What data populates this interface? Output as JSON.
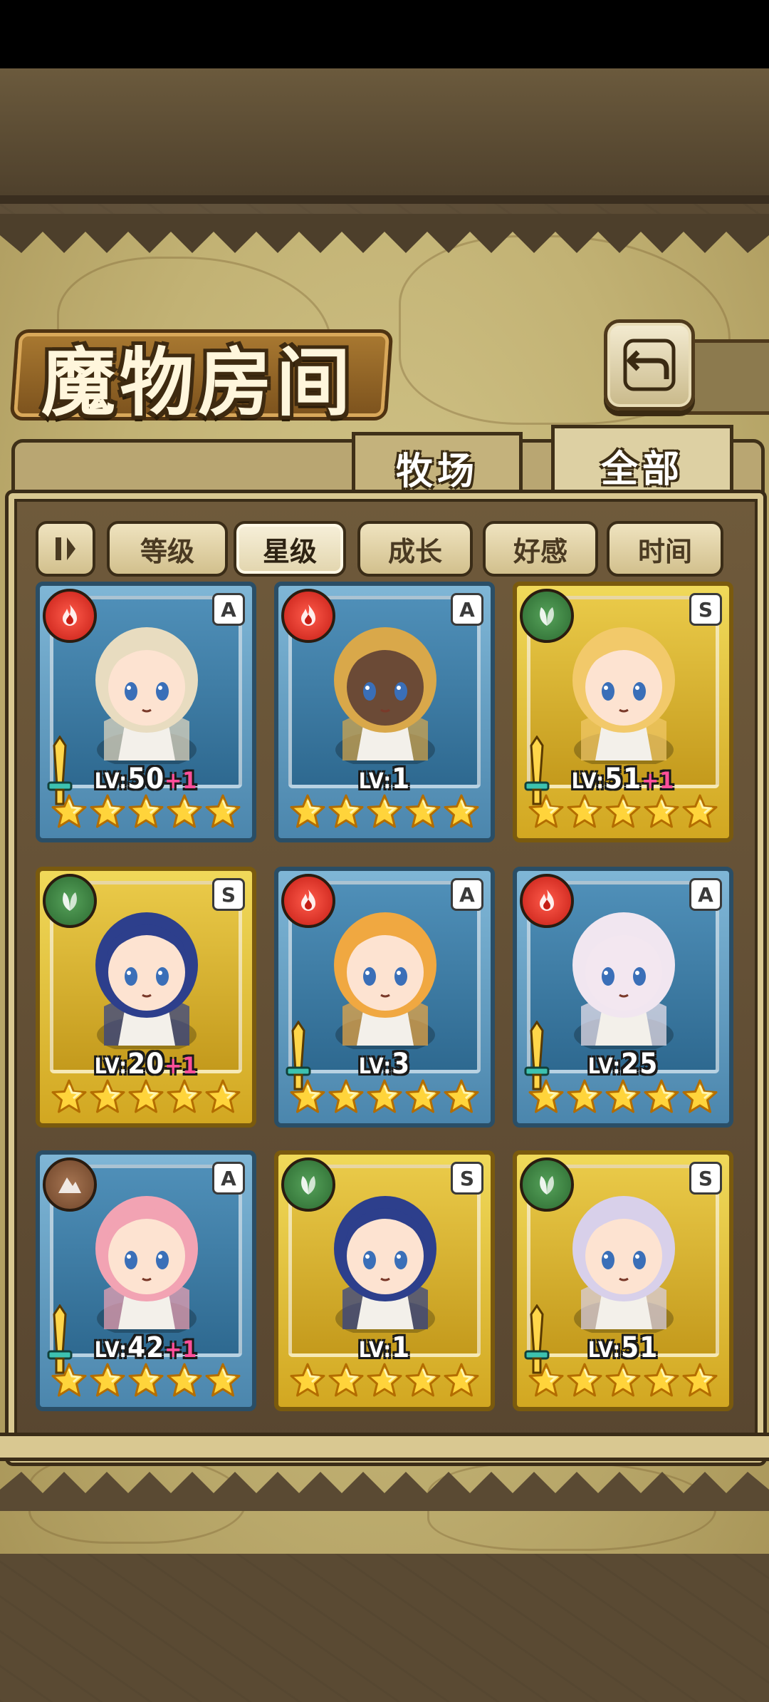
{
  "header": {
    "title": "魔物房间"
  },
  "tabs": [
    {
      "label": "牧场",
      "active": false
    },
    {
      "label": "全部",
      "active": true
    }
  ],
  "sort": {
    "buttons": [
      {
        "label": "等级",
        "active": false
      },
      {
        "label": "星级",
        "active": true
      },
      {
        "label": "成长",
        "active": false
      },
      {
        "label": "好感",
        "active": false
      },
      {
        "label": "时间",
        "active": false
      }
    ]
  },
  "monsters": [
    {
      "element": "fire",
      "rank": "A",
      "level_label": "LV:",
      "level": "50",
      "bonus": "+1",
      "stars": 5,
      "weapon": true,
      "hair": "#e8dcc0",
      "skin": "#fde3d1"
    },
    {
      "element": "fire",
      "rank": "A",
      "level_label": "LV:",
      "level": "1",
      "bonus": "",
      "stars": 5,
      "weapon": false,
      "hair": "#d9a84a",
      "skin": "#6b4a36"
    },
    {
      "element": "wood",
      "rank": "S",
      "level_label": "LV:",
      "level": "51",
      "bonus": "+1",
      "stars": 5,
      "weapon": true,
      "hair": "#f2c96a",
      "skin": "#fde3d1"
    },
    {
      "element": "wood",
      "rank": "S",
      "level_label": "LV:",
      "level": "20",
      "bonus": "+1",
      "stars": 5,
      "weapon": false,
      "hair": "#2d3f8c",
      "skin": "#fde3d1"
    },
    {
      "element": "fire",
      "rank": "A",
      "level_label": "LV:",
      "level": "3",
      "bonus": "",
      "stars": 5,
      "weapon": true,
      "hair": "#f0a841",
      "skin": "#fde3d1"
    },
    {
      "element": "fire",
      "rank": "A",
      "level_label": "LV:",
      "level": "25",
      "bonus": "",
      "stars": 5,
      "weapon": true,
      "hair": "#f1e6f0",
      "skin": "#f3e7f0"
    },
    {
      "element": "earth",
      "rank": "A",
      "level_label": "LV:",
      "level": "42",
      "bonus": "+1",
      "stars": 5,
      "weapon": true,
      "hair": "#f2a3b3",
      "skin": "#fde3d1"
    },
    {
      "element": "wood",
      "rank": "S",
      "level_label": "LV:",
      "level": "1",
      "bonus": "",
      "stars": 5,
      "weapon": false,
      "hair": "#2d3f8c",
      "skin": "#fde3d1"
    },
    {
      "element": "wood",
      "rank": "S",
      "level_label": "LV:",
      "level": "51",
      "bonus": "",
      "stars": 5,
      "weapon": true,
      "hair": "#d8d0ea",
      "skin": "#fde3d1"
    }
  ]
}
